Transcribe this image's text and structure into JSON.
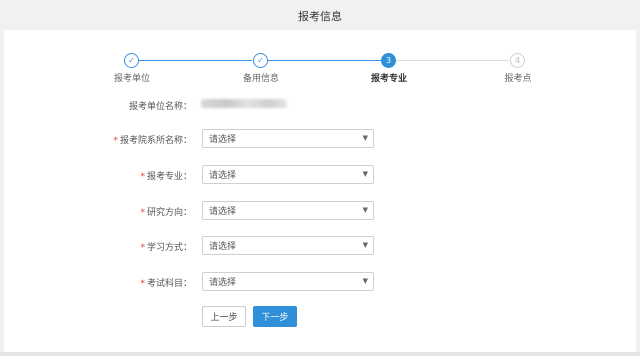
{
  "header": {
    "title": "报考信息"
  },
  "steps": [
    {
      "label": "报考单位",
      "number": "✓",
      "state": "done"
    },
    {
      "label": "备用信息",
      "number": "✓",
      "state": "done"
    },
    {
      "label": "报考专业",
      "number": "3",
      "state": "active"
    },
    {
      "label": "报考点",
      "number": "4",
      "state": "todo"
    }
  ],
  "form": {
    "unit_label": "报考单位名称：",
    "fields": [
      {
        "label": "报考院系所名称：",
        "value": "请选择",
        "required": true
      },
      {
        "label": "报考专业：",
        "value": "请选择",
        "required": true
      },
      {
        "label": "研究方向：",
        "value": "请选择",
        "required": true
      },
      {
        "label": "学习方式：",
        "value": "请选择",
        "required": true
      },
      {
        "label": "考试科目：",
        "value": "请选择",
        "required": true
      }
    ],
    "required_mark": "*",
    "caret": "▼"
  },
  "buttons": {
    "prev": "上一步",
    "next": "下一步"
  },
  "colors": {
    "accent": "#2f8fd8",
    "required": "#e33333",
    "step_done": "#3a8ee6"
  }
}
